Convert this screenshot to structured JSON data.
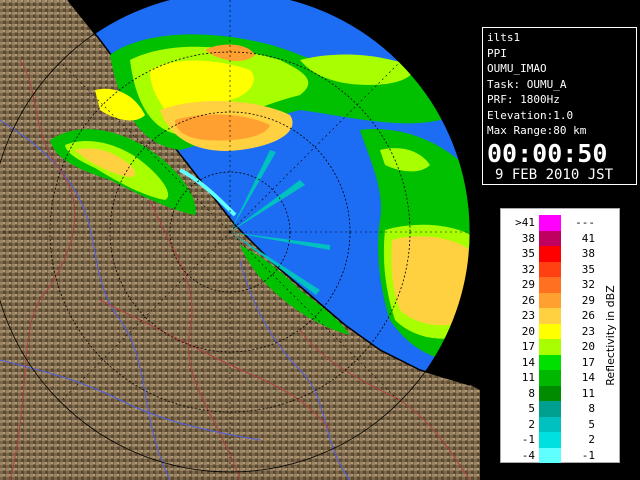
{
  "info": {
    "site": "ilts1",
    "product": "PPI",
    "radar_id": "OUMU_IMAO",
    "task": "Task: OUMU_A",
    "prf": "PRF: 1800Hz",
    "elevation": "Elevation:1.0",
    "max_range": "Max Range:80 km",
    "time": "00:00:50",
    "date": "9 FEB 2010 JST"
  },
  "legend": {
    "unit": "Reflectivity in dBZ",
    "rows": [
      {
        "low": ">41",
        "high": "---",
        "color": "#ff00ff"
      },
      {
        "low": "38",
        "high": "41",
        "color": "#c00060"
      },
      {
        "low": "35",
        "high": "38",
        "color": "#ff0000"
      },
      {
        "low": "32",
        "high": "35",
        "color": "#ff4010"
      },
      {
        "low": "29",
        "high": "32",
        "color": "#ff7020"
      },
      {
        "low": "26",
        "high": "29",
        "color": "#ffa030"
      },
      {
        "low": "23",
        "high": "26",
        "color": "#ffd040"
      },
      {
        "low": "20",
        "high": "23",
        "color": "#ffff00"
      },
      {
        "low": "17",
        "high": "20",
        "color": "#a8ff00"
      },
      {
        "low": "14",
        "high": "17",
        "color": "#00e000"
      },
      {
        "low": "11",
        "high": "14",
        "color": "#00b800"
      },
      {
        "low": "8",
        "high": "11",
        "color": "#008c00"
      },
      {
        "low": "5",
        "high": "8",
        "color": "#00a090"
      },
      {
        "low": "2",
        "high": "5",
        "color": "#00c0c0"
      },
      {
        "low": "-1",
        "high": "2",
        "color": "#00e0e0"
      },
      {
        "low": "-4",
        "high": "-1",
        "color": "#60ffff"
      }
    ]
  },
  "colors": {
    "radar_background": "#1c6cf4",
    "terrain": "#7a6648",
    "range_rings": "#000000"
  }
}
